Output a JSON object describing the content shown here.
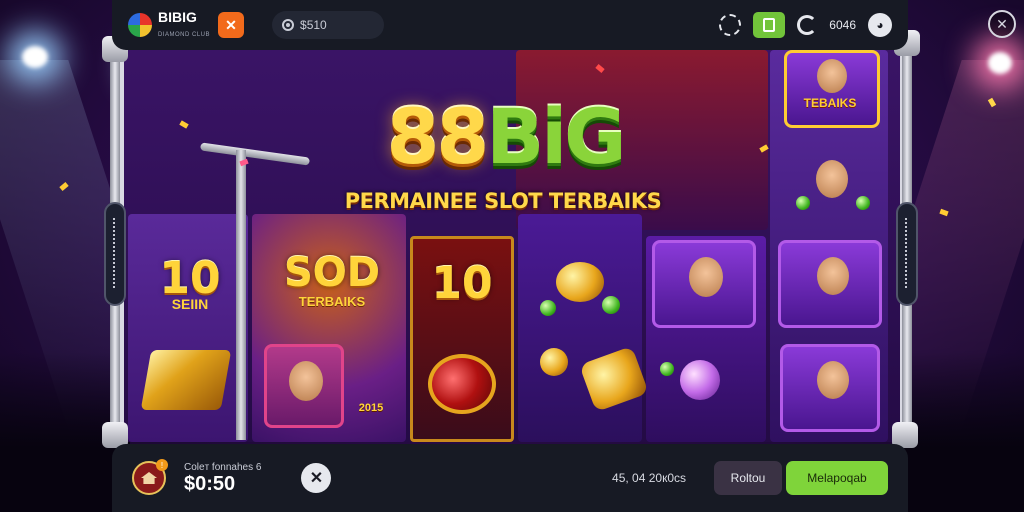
{
  "topbar": {
    "brand_main": "BIBIG",
    "brand_sub": "DIAMOND CLUB",
    "share_symbol": "✕",
    "balance": "$510",
    "count": "6046",
    "user_symbol": "◕"
  },
  "close_symbol": "✕",
  "headline": {
    "part1": "88",
    "part2": "BiG",
    "subtitle": "PERMAINEE SLOT TERBAIKS"
  },
  "symbols": {
    "ten_a": "10",
    "seln": "SEIIN",
    "sod": "SOD",
    "terbaiks": "TERBAIKS",
    "ten_b": "10",
    "year": "2015",
    "sign": "TEBAIKS"
  },
  "bottombar": {
    "home_badge": "!",
    "bet_label": "Coleт fonnahes 6",
    "bet_value": "$0:50",
    "close_symbol": "✕",
    "status": "45, 04 20к0сs",
    "ghost_label": "Roltou",
    "primary_label": "Melapoqab"
  },
  "colors": {
    "accent_green": "#7fd43a",
    "gold": "#ffd84a",
    "bar_bg": "#171a24",
    "share_orange": "#f26a1b"
  }
}
